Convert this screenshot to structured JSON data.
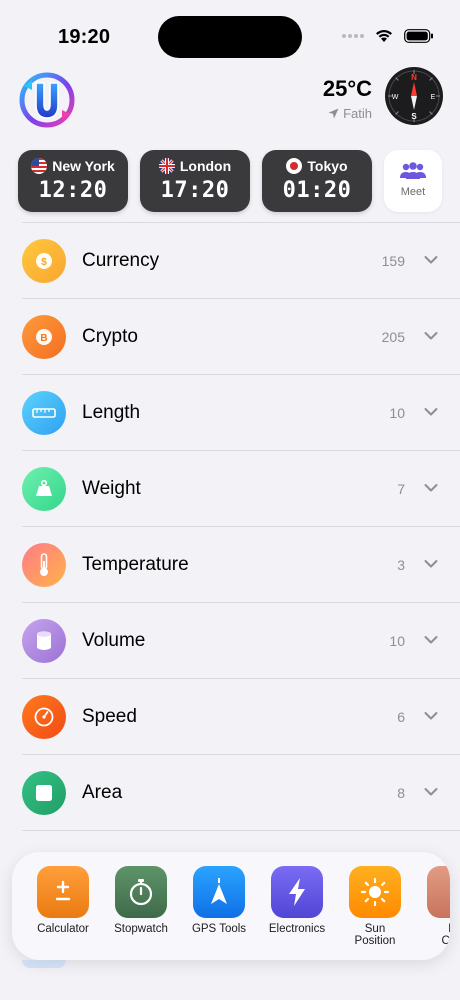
{
  "status": {
    "time": "19:20"
  },
  "header": {
    "temperature": "25°C",
    "location": "Fatih"
  },
  "compass": {
    "n": "N",
    "s": "S",
    "e": "E",
    "w": "W"
  },
  "clocks": [
    {
      "city": "New York",
      "time": "12:20"
    },
    {
      "city": "London",
      "time": "17:20"
    },
    {
      "city": "Tokyo",
      "time": "01:20"
    }
  ],
  "meet": {
    "label": "Meet"
  },
  "categories": [
    {
      "label": "Currency",
      "count": "159",
      "color": "#fbb13c"
    },
    {
      "label": "Crypto",
      "count": "205",
      "color": "#f7822c"
    },
    {
      "label": "Length",
      "count": "10",
      "color": "#3fb6f5"
    },
    {
      "label": "Weight",
      "count": "7",
      "color": "#4fdd9a"
    },
    {
      "label": "Temperature",
      "count": "3",
      "color": "#ff8a73"
    },
    {
      "label": "Volume",
      "count": "10",
      "color": "#b693e0"
    },
    {
      "label": "Speed",
      "count": "6",
      "color": "#ff5a1f"
    },
    {
      "label": "Area",
      "count": "8",
      "color": "#27b074"
    }
  ],
  "tools": [
    {
      "label": "Calculator",
      "color": "#f5902b",
      "icon": "plus-minus-icon"
    },
    {
      "label": "Stopwatch",
      "color": "#4c7d58",
      "icon": "stopwatch-icon"
    },
    {
      "label": "GPS Tools",
      "color": "#1c8cf5",
      "icon": "navigation-icon"
    },
    {
      "label": "Electronics",
      "color": "#6458e6",
      "icon": "bolt-icon"
    },
    {
      "label": "Sun\nPosition",
      "color": "#ff9a0a",
      "icon": "sun-icon"
    },
    {
      "label": "M\nCalc",
      "color": "#d88a73",
      "icon": "partial-icon"
    }
  ]
}
